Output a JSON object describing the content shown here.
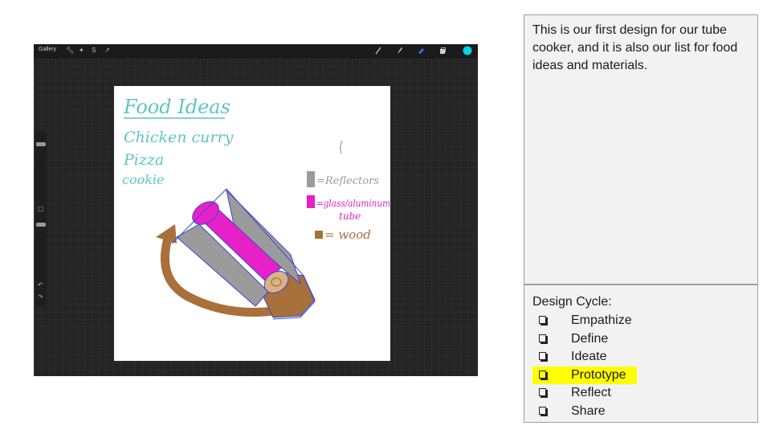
{
  "app": {
    "gallery_label": "Gallery",
    "toolbar_left_icons": [
      "wrench-icon",
      "magic-wand-icon",
      "selection-icon",
      "transform-arrow-icon"
    ],
    "toolbar_right_icons": [
      "brush-icon",
      "smudge-icon",
      "eraser-icon",
      "layers-icon",
      "color-swatch-icon"
    ],
    "color_swatch": "#00d5e0",
    "sidebar_icons": [
      "brush-size-slider",
      "modify-button",
      "opacity-slider",
      "undo-icon",
      "redo-icon"
    ]
  },
  "drawing": {
    "title": "Food Ideas",
    "food_items": [
      "Chicken curry",
      "Pizza",
      "cookie"
    ],
    "legend": [
      {
        "label": "=Reflectors",
        "color": "#9b9b9b"
      },
      {
        "label": "=glass/aluminum",
        "label2": "tube",
        "color": "#e820c8"
      },
      {
        "label": "= wood",
        "color": "#a8703a"
      }
    ],
    "ink_colors": {
      "teal": "#5fc4c4",
      "gray": "#9b9b9b",
      "magenta": "#e820c8",
      "brown": "#a8703a",
      "blue": "#3a4ad0"
    }
  },
  "description": "This is our first design for our tube cooker, and it is also our list for food ideas and materials.",
  "design_cycle": {
    "title": "Design Cycle:",
    "items": [
      {
        "label": "Empathize",
        "highlight": false
      },
      {
        "label": "Define",
        "highlight": false
      },
      {
        "label": "Ideate",
        "highlight": false
      },
      {
        "label": "Prototype",
        "highlight": true
      },
      {
        "label": "Reflect",
        "highlight": false
      },
      {
        "label": "Share",
        "highlight": false
      }
    ],
    "highlight_color": "#ffff00"
  }
}
